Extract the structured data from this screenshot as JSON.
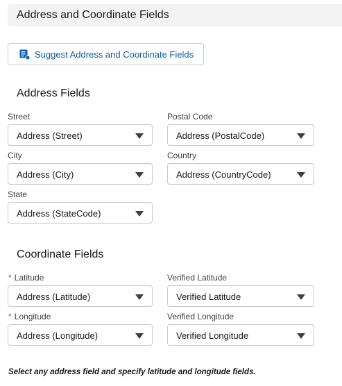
{
  "header": {
    "title": "Address and Coordinate Fields"
  },
  "suggest_button": {
    "label": "Suggest Address and Coordinate Fields",
    "icon": "suggest-list-icon"
  },
  "address_section": {
    "title": "Address Fields",
    "street": {
      "label": "Street",
      "value": "Address (Street)"
    },
    "postal_code": {
      "label": "Postal Code",
      "value": "Address (PostalCode)"
    },
    "city": {
      "label": "City",
      "value": "Address (City)"
    },
    "country": {
      "label": "Country",
      "value": "Address (CountryCode)"
    },
    "state": {
      "label": "State",
      "value": "Address (StateCode)"
    }
  },
  "coordinate_section": {
    "title": "Coordinate Fields",
    "required_marker": "*",
    "latitude": {
      "label": "Latitude",
      "value": "Address (Latitude)",
      "required": true
    },
    "verified_latitude": {
      "label": "Verified Latitude",
      "value": "Verified Latitude"
    },
    "longitude": {
      "label": "Longitude",
      "value": "Address (Longitude)",
      "required": true
    },
    "verified_longitude": {
      "label": "Verified Longitude",
      "value": "Verified Longitude"
    }
  },
  "footnote": "Select any address field and specify latitude and longitude fields.",
  "colors": {
    "accent": "#0b5cab",
    "required": "#c23934",
    "header_bg": "#f3f3f3",
    "border": "#c9c9c9"
  }
}
